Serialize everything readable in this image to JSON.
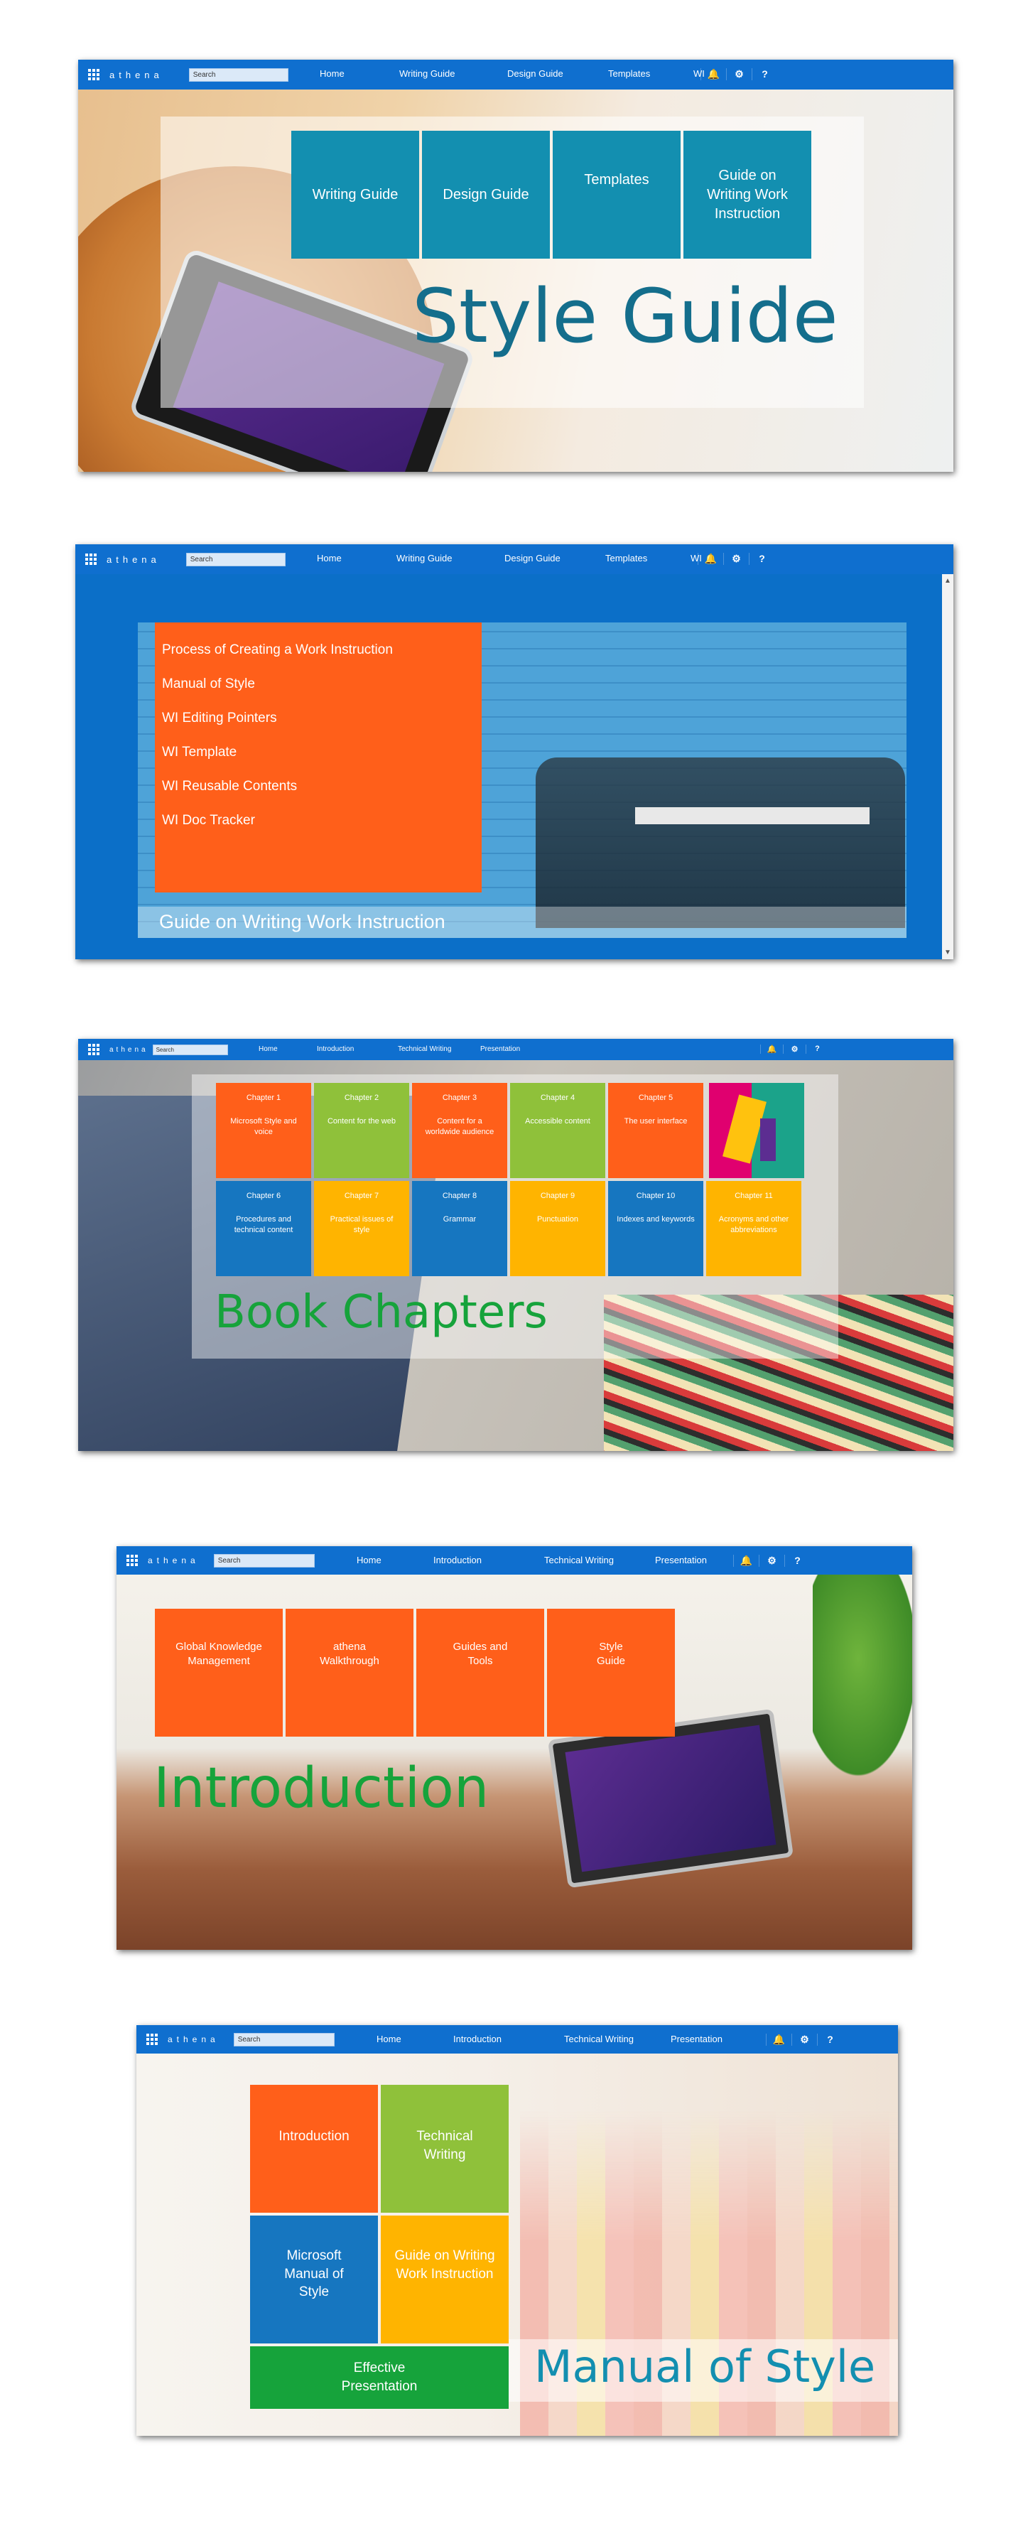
{
  "brand": "athena",
  "search_placeholder": "Search",
  "colors": {
    "bar": "#0f6fcf",
    "teal": "#138fb0",
    "orange": "#ff5f1a",
    "green": "#8fc13a",
    "yellow": "#ffb400",
    "blue": "#1676c0",
    "darkgreen": "#16a33b"
  },
  "s1": {
    "nav": [
      "Home",
      "Writing Guide",
      "Design Guide",
      "Templates",
      "WI"
    ],
    "tiles": [
      "Writing Guide",
      "Design Guide",
      "Templates",
      "Guide on Writing Work Instruction"
    ],
    "title": "Style Guide"
  },
  "s2": {
    "nav": [
      "Home",
      "Writing Guide",
      "Design Guide",
      "Templates",
      "WI"
    ],
    "links": [
      "Process of Creating a Work Instruction",
      "Manual of Style",
      "WI Editing Pointers",
      "WI Template",
      "WI Reusable Contents",
      "WI Doc Tracker"
    ],
    "caption": "Guide on Writing Work Instruction"
  },
  "s3": {
    "nav": [
      "Home",
      "Introduction",
      "Technical Writing",
      "Presentation"
    ],
    "chapters": [
      {
        "num": "Chapter 1",
        "name": "Microsoft Style and voice"
      },
      {
        "num": "Chapter 2",
        "name": "Content for the web"
      },
      {
        "num": "Chapter 3",
        "name": "Content for a worldwide audience"
      },
      {
        "num": "Chapter 4",
        "name": "Accessible content"
      },
      {
        "num": "Chapter 5",
        "name": "The user interface"
      },
      {
        "num": "Chapter 6",
        "name": "Procedures and technical content"
      },
      {
        "num": "Chapter 7",
        "name": "Practical issues of style"
      },
      {
        "num": "Chapter 8",
        "name": "Grammar"
      },
      {
        "num": "Chapter 9",
        "name": "Punctuation"
      },
      {
        "num": "Chapter 10",
        "name": "Indexes and keywords"
      },
      {
        "num": "Chapter 11",
        "name": "Acronyms and other abbreviations"
      }
    ],
    "title": "Book Chapters"
  },
  "s4": {
    "nav": [
      "Home",
      "Introduction",
      "Technical Writing",
      "Presentation"
    ],
    "tiles": [
      "Global Knowledge Management",
      "athena Walkthrough",
      "Guides and Tools",
      "Style Guide"
    ],
    "title": "Introduction"
  },
  "s5": {
    "nav": [
      "Home",
      "Introduction",
      "Technical Writing",
      "Presentation"
    ],
    "tiles": [
      "Introduction",
      "Technical Writing",
      "Microsoft Manual of Style",
      "Guide on Writing Work Instruction",
      "Effective Presentation"
    ],
    "title": "Manual of Style"
  },
  "icons": [
    "bell-icon",
    "gear-icon",
    "help-icon"
  ]
}
